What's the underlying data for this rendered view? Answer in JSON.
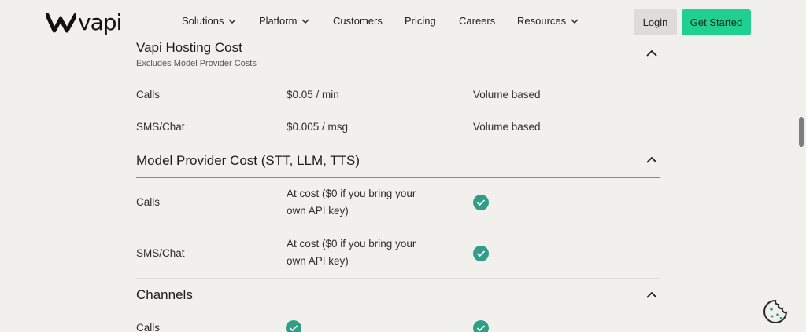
{
  "brand": {
    "logo_text": "vapi"
  },
  "nav": {
    "items": [
      {
        "label": "Solutions",
        "dropdown": true
      },
      {
        "label": "Platform",
        "dropdown": true
      },
      {
        "label": "Customers",
        "dropdown": false
      },
      {
        "label": "Pricing",
        "dropdown": false
      },
      {
        "label": "Careers",
        "dropdown": false
      },
      {
        "label": "Resources",
        "dropdown": true
      }
    ],
    "login_label": "Login",
    "get_started_label": "Get Started"
  },
  "colors": {
    "accent": "#1fd091",
    "check": "#2f9e86",
    "background": "#f1f0ed"
  },
  "sections": {
    "hosting": {
      "title": "Vapi Hosting Cost",
      "subtitle": "Excludes Model Provider Costs",
      "rows": [
        {
          "label": "Calls",
          "price": "$0.05 / min",
          "note": "Volume based"
        },
        {
          "label": "SMS/Chat",
          "price": "$0.005 / msg",
          "note": "Volume based"
        }
      ]
    },
    "provider": {
      "title": "Model Provider Cost (STT, LLM, TTS)",
      "rows": [
        {
          "label": "Calls",
          "price_line1": "At cost ($0 if you bring your",
          "price_line2": "own API key)",
          "included": true
        },
        {
          "label": "SMS/Chat",
          "price_line1": "At cost ($0 if you bring your",
          "price_line2": "own API key)",
          "included": true
        }
      ]
    },
    "channels": {
      "title": "Channels",
      "rows": [
        {
          "label": "Calls",
          "col2_included": true,
          "col3_included": true
        }
      ]
    }
  },
  "icons": [
    "chevron-down-icon",
    "chevron-up-icon",
    "check-icon",
    "cookie-icon",
    "vapi-logo-icon"
  ]
}
